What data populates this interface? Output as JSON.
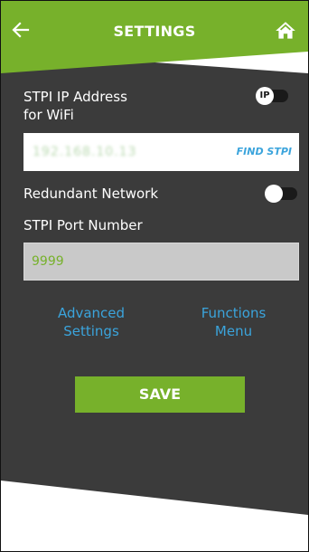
{
  "header": {
    "title": "SETTINGS",
    "back_icon": "arrow-left-icon",
    "home_icon": "home-icon"
  },
  "wifi": {
    "label": "STPI IP Address\nfor WiFi",
    "toggle_badge": "IP",
    "ip_value": "192.168.10.13",
    "find_button": "FIND STPI"
  },
  "network": {
    "redundant_label": "Redundant Network",
    "redundant_enabled": false
  },
  "port": {
    "label": "STPI Port Number",
    "value": "9999"
  },
  "links": {
    "advanced": "Advanced\nSettings",
    "functions": "Functions\nMenu"
  },
  "actions": {
    "save_label": "SAVE"
  },
  "colors": {
    "brand_green": "#77b12b",
    "panel_dark": "#3b3b3b",
    "link_blue": "#3ba4dc"
  }
}
